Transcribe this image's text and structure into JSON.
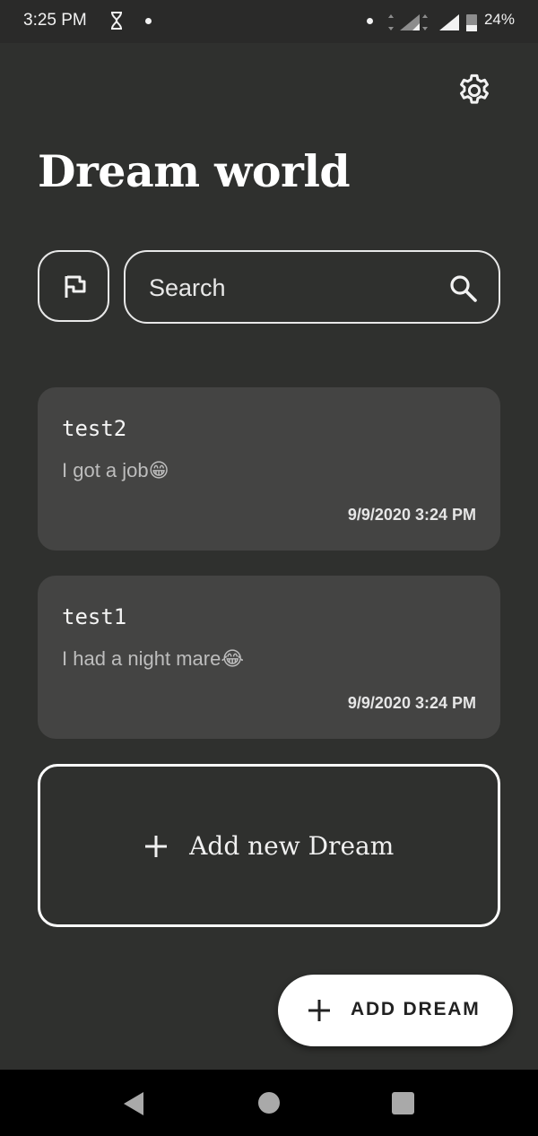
{
  "status_bar": {
    "time": "3:25 PM",
    "battery": "24%",
    "icons": [
      "hourglass-icon",
      "notification-dot",
      "signal-icon",
      "battery-icon"
    ]
  },
  "header": {
    "title": "Dream world",
    "settings_icon": "gear-icon"
  },
  "search": {
    "placeholder": "Search",
    "flag_icon": "flag-icon",
    "search_icon": "search-icon"
  },
  "dreams": [
    {
      "title": "test2",
      "body": "I got a job",
      "emoji": "😁",
      "date": "9/9/2020 3:24 PM"
    },
    {
      "title": "test1",
      "body": "I had a night mare",
      "emoji": "😂",
      "date": "9/9/2020 3:24 PM"
    }
  ],
  "add_card": {
    "label": "Add new Dream"
  },
  "fab": {
    "label": "ADD DREAM"
  },
  "colors": {
    "background": "#2f302e",
    "card": "#444443",
    "fab": "#ffffff"
  }
}
